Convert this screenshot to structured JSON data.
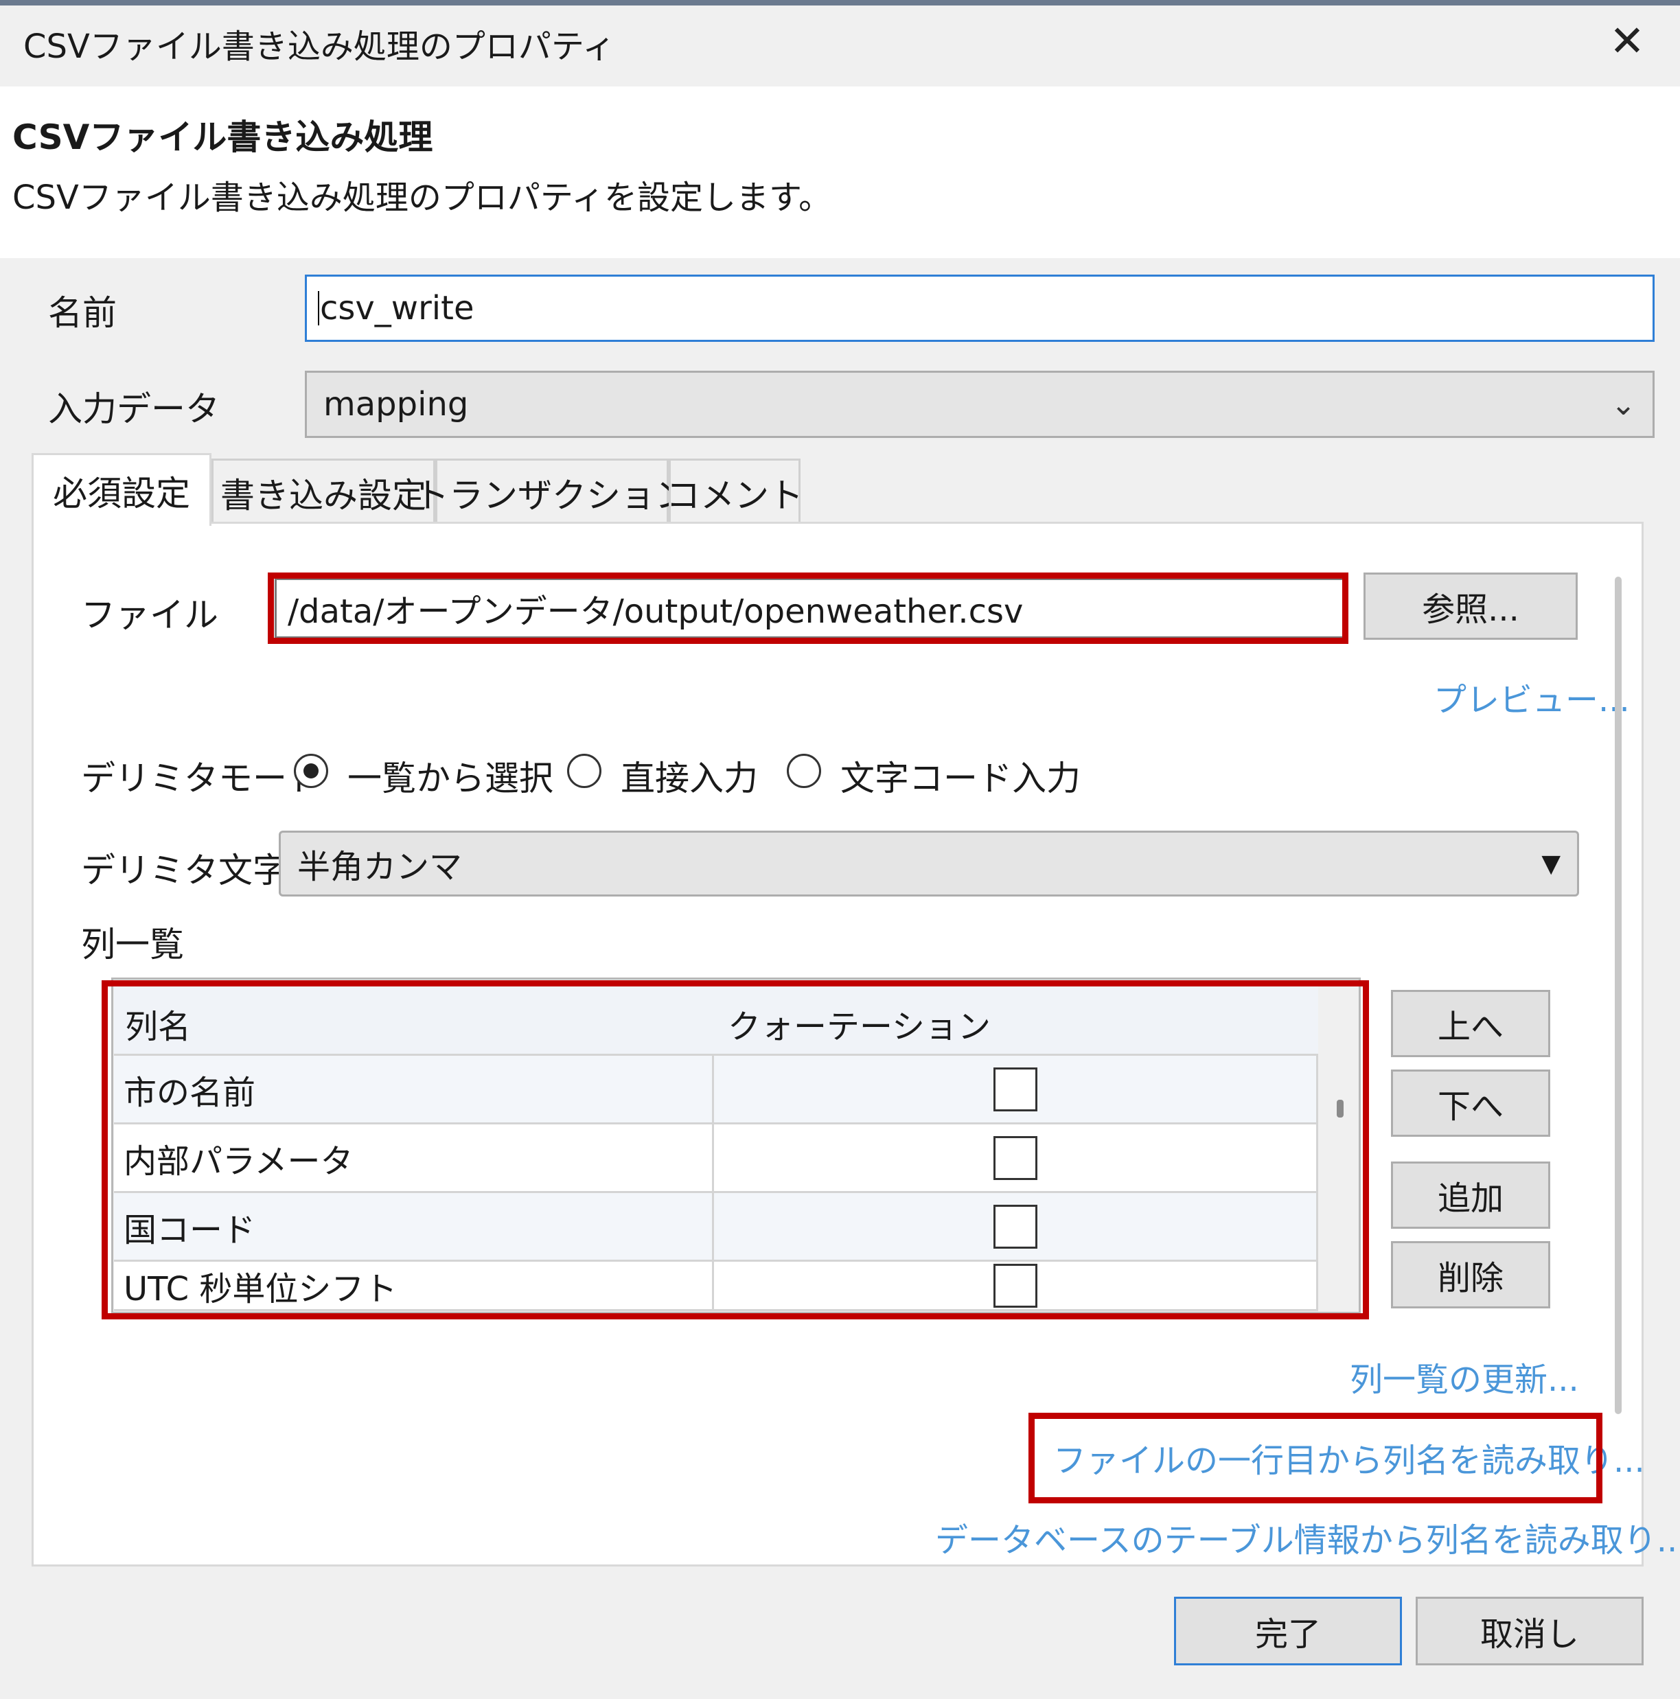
{
  "window": {
    "title": "CSVファイル書き込み処理のプロパティ",
    "close_glyph": "✕"
  },
  "header": {
    "title": "CSVファイル書き込み処理",
    "description": "CSVファイル書き込み処理のプロパティを設定します。"
  },
  "fields": {
    "name_label": "名前",
    "name_value": "csv_write",
    "input_label": "入力データ",
    "input_value": "mapping"
  },
  "tabs": [
    {
      "label": "必須設定",
      "active": true
    },
    {
      "label": "書き込み設定",
      "active": false
    },
    {
      "label": "トランザクション",
      "active": false
    },
    {
      "label": "コメント",
      "active": false
    }
  ],
  "required": {
    "file_label": "ファイル",
    "file_value": "/data/オープンデータ/output/openweather.csv",
    "browse_label": "参照...",
    "preview_link": "プレビュー...",
    "delimiter_mode_label": "デリミタモード",
    "delimiter_modes": [
      {
        "label": "一覧から選択",
        "selected": true
      },
      {
        "label": "直接入力",
        "selected": false
      },
      {
        "label": "文字コード入力",
        "selected": false
      }
    ],
    "delimiter_char_label": "デリミタ文字",
    "delimiter_char_value": "半角カンマ",
    "column_list_label": "列一覧",
    "table": {
      "headers": [
        "列名",
        "クォーテーション"
      ],
      "rows": [
        {
          "name": "市の名前",
          "quote": false
        },
        {
          "name": "内部パラメータ",
          "quote": false
        },
        {
          "name": "国コード",
          "quote": false
        },
        {
          "name": "UTC 秒単位シフト",
          "quote": false
        }
      ]
    },
    "side_buttons": [
      "上へ",
      "下へ",
      "追加",
      "削除"
    ],
    "links": {
      "refresh": "列一覧の更新...",
      "read_first_row": "ファイルの一行目から列名を読み取り...",
      "read_db_table": "データベースのテーブル情報から列名を読み取り..."
    }
  },
  "footer": {
    "ok_label": "完了",
    "cancel_label": "取消し"
  },
  "colors": {
    "accent_border": "#2f7fd6",
    "link": "#4a96d9",
    "highlight_box": "#c00000",
    "dialog_bg": "#f0f0f0"
  }
}
